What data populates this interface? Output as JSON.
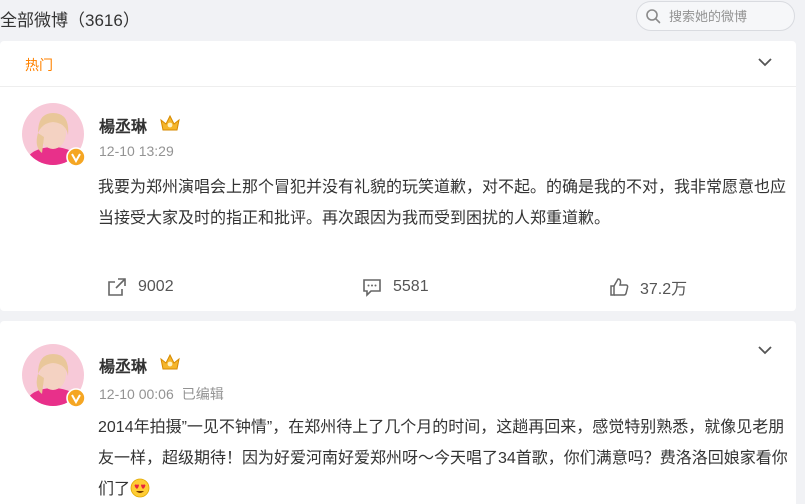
{
  "header": {
    "title": "全部微博（3616）",
    "search_placeholder": "搜索她的微博"
  },
  "posts": [
    {
      "section_label": "热门",
      "username": "楊丞琳",
      "time": "12-10 13:29",
      "edited": "",
      "text": "我要为郑州演唱会上那个冒犯并没有礼貌的玩笑道歉，对不起。的确是我的不对，我非常愿意也应当接受大家及时的指正和批评。再次跟因为我而受到困扰的人郑重道歉。",
      "repost_count": "9002",
      "comment_count": "5581",
      "like_count": "37.2万"
    },
    {
      "username": "楊丞琳",
      "time": "12-10 00:06",
      "edited": "已编辑",
      "text": "2014年拍摄”一见不钟情”，在郑州待上了几个月的时间，这趟再回来，感觉特别熟悉，就像见老朋友一样，超级期待！因为好爱河南好爱郑州呀～今天唱了34首歌，你们满意吗？费洛洛回娘家看你们了"
    }
  ],
  "colors": {
    "accent": "#ff8200",
    "verified": "#f5a623",
    "background": "#f1f2f5"
  },
  "icons": [
    "search-icon",
    "chevron-down-icon",
    "verified-badge-icon",
    "crown-icon",
    "repost-icon",
    "comment-icon",
    "like-icon",
    "heart-eyes-emoji"
  ]
}
